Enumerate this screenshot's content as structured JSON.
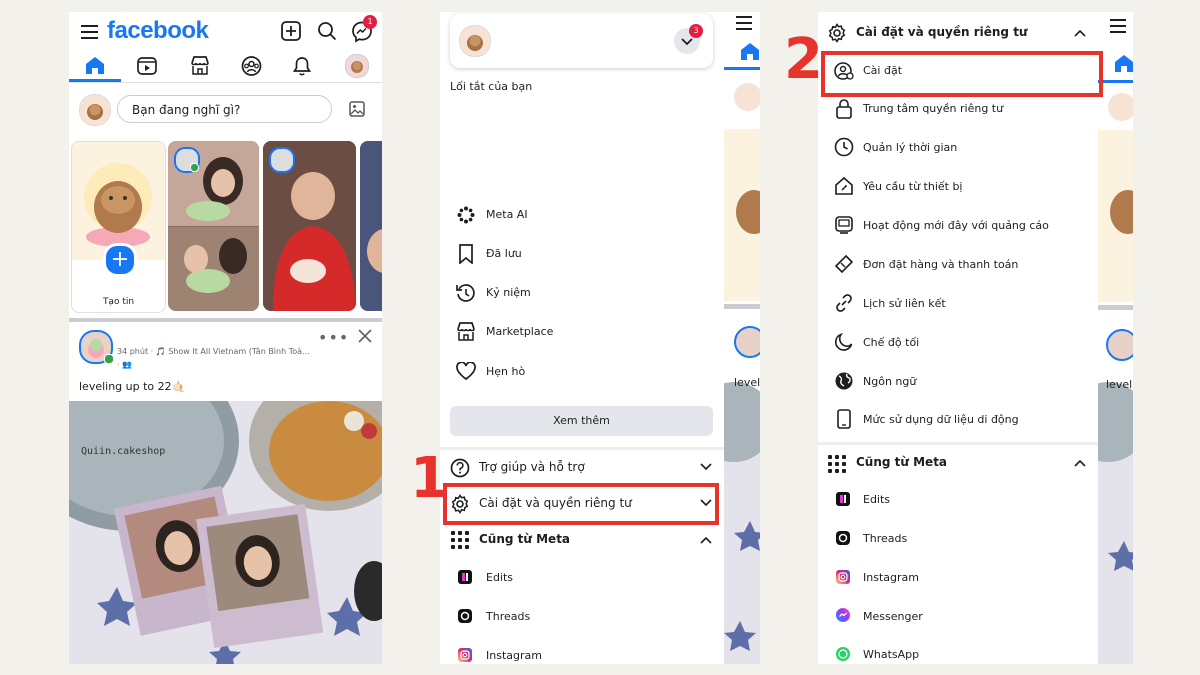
{
  "panel1": {
    "logo": "facebook",
    "notif_count": "1",
    "composer_placeholder": "Bạn đang nghĩ gì?",
    "create_story_label": "Tạo tin",
    "post_meta": "34 phút · 🎵 Show It All Vietnam (Tân Bình Toà...",
    "post_meta2": "· 👥",
    "post_caption": "leveling up to 22🤙🏻",
    "photo_text": "Quiin.cakeshop"
  },
  "panel2": {
    "badge": "3",
    "shortcuts_label": "Lối tắt của bạn",
    "menu": [
      "Meta AI",
      "Đã lưu",
      "Kỷ niệm",
      "Marketplace",
      "Hẹn hò"
    ],
    "see_more": "Xem thêm",
    "help": "Trợ giúp và hỗ trợ",
    "settings": "Cài đặt và quyền riêng tư",
    "from_meta": "Cũng từ Meta",
    "apps": [
      "Edits",
      "Threads",
      "Instagram"
    ],
    "step": "1"
  },
  "panel3": {
    "header": "Cài đặt và quyền riêng tư",
    "items": [
      "Cài đặt",
      "Trung tâm quyền riêng tư",
      "Quản lý thời gian",
      "Yêu cầu từ thiết bị",
      "Hoạt động mới đây với quảng cáo",
      "Đơn đặt hàng và thanh toán",
      "Lịch sử liên kết",
      "Chế độ tối",
      "Ngôn ngữ",
      "Mức sử dụng dữ liệu di động"
    ],
    "from_meta": "Cũng từ Meta",
    "apps": [
      "Edits",
      "Threads",
      "Instagram",
      "Messenger",
      "WhatsApp"
    ],
    "step": "2",
    "behind_text": "leveli",
    "behind_text2": "level"
  },
  "colors": {
    "brand": "#1877f2",
    "highlight": "#e8322c"
  }
}
